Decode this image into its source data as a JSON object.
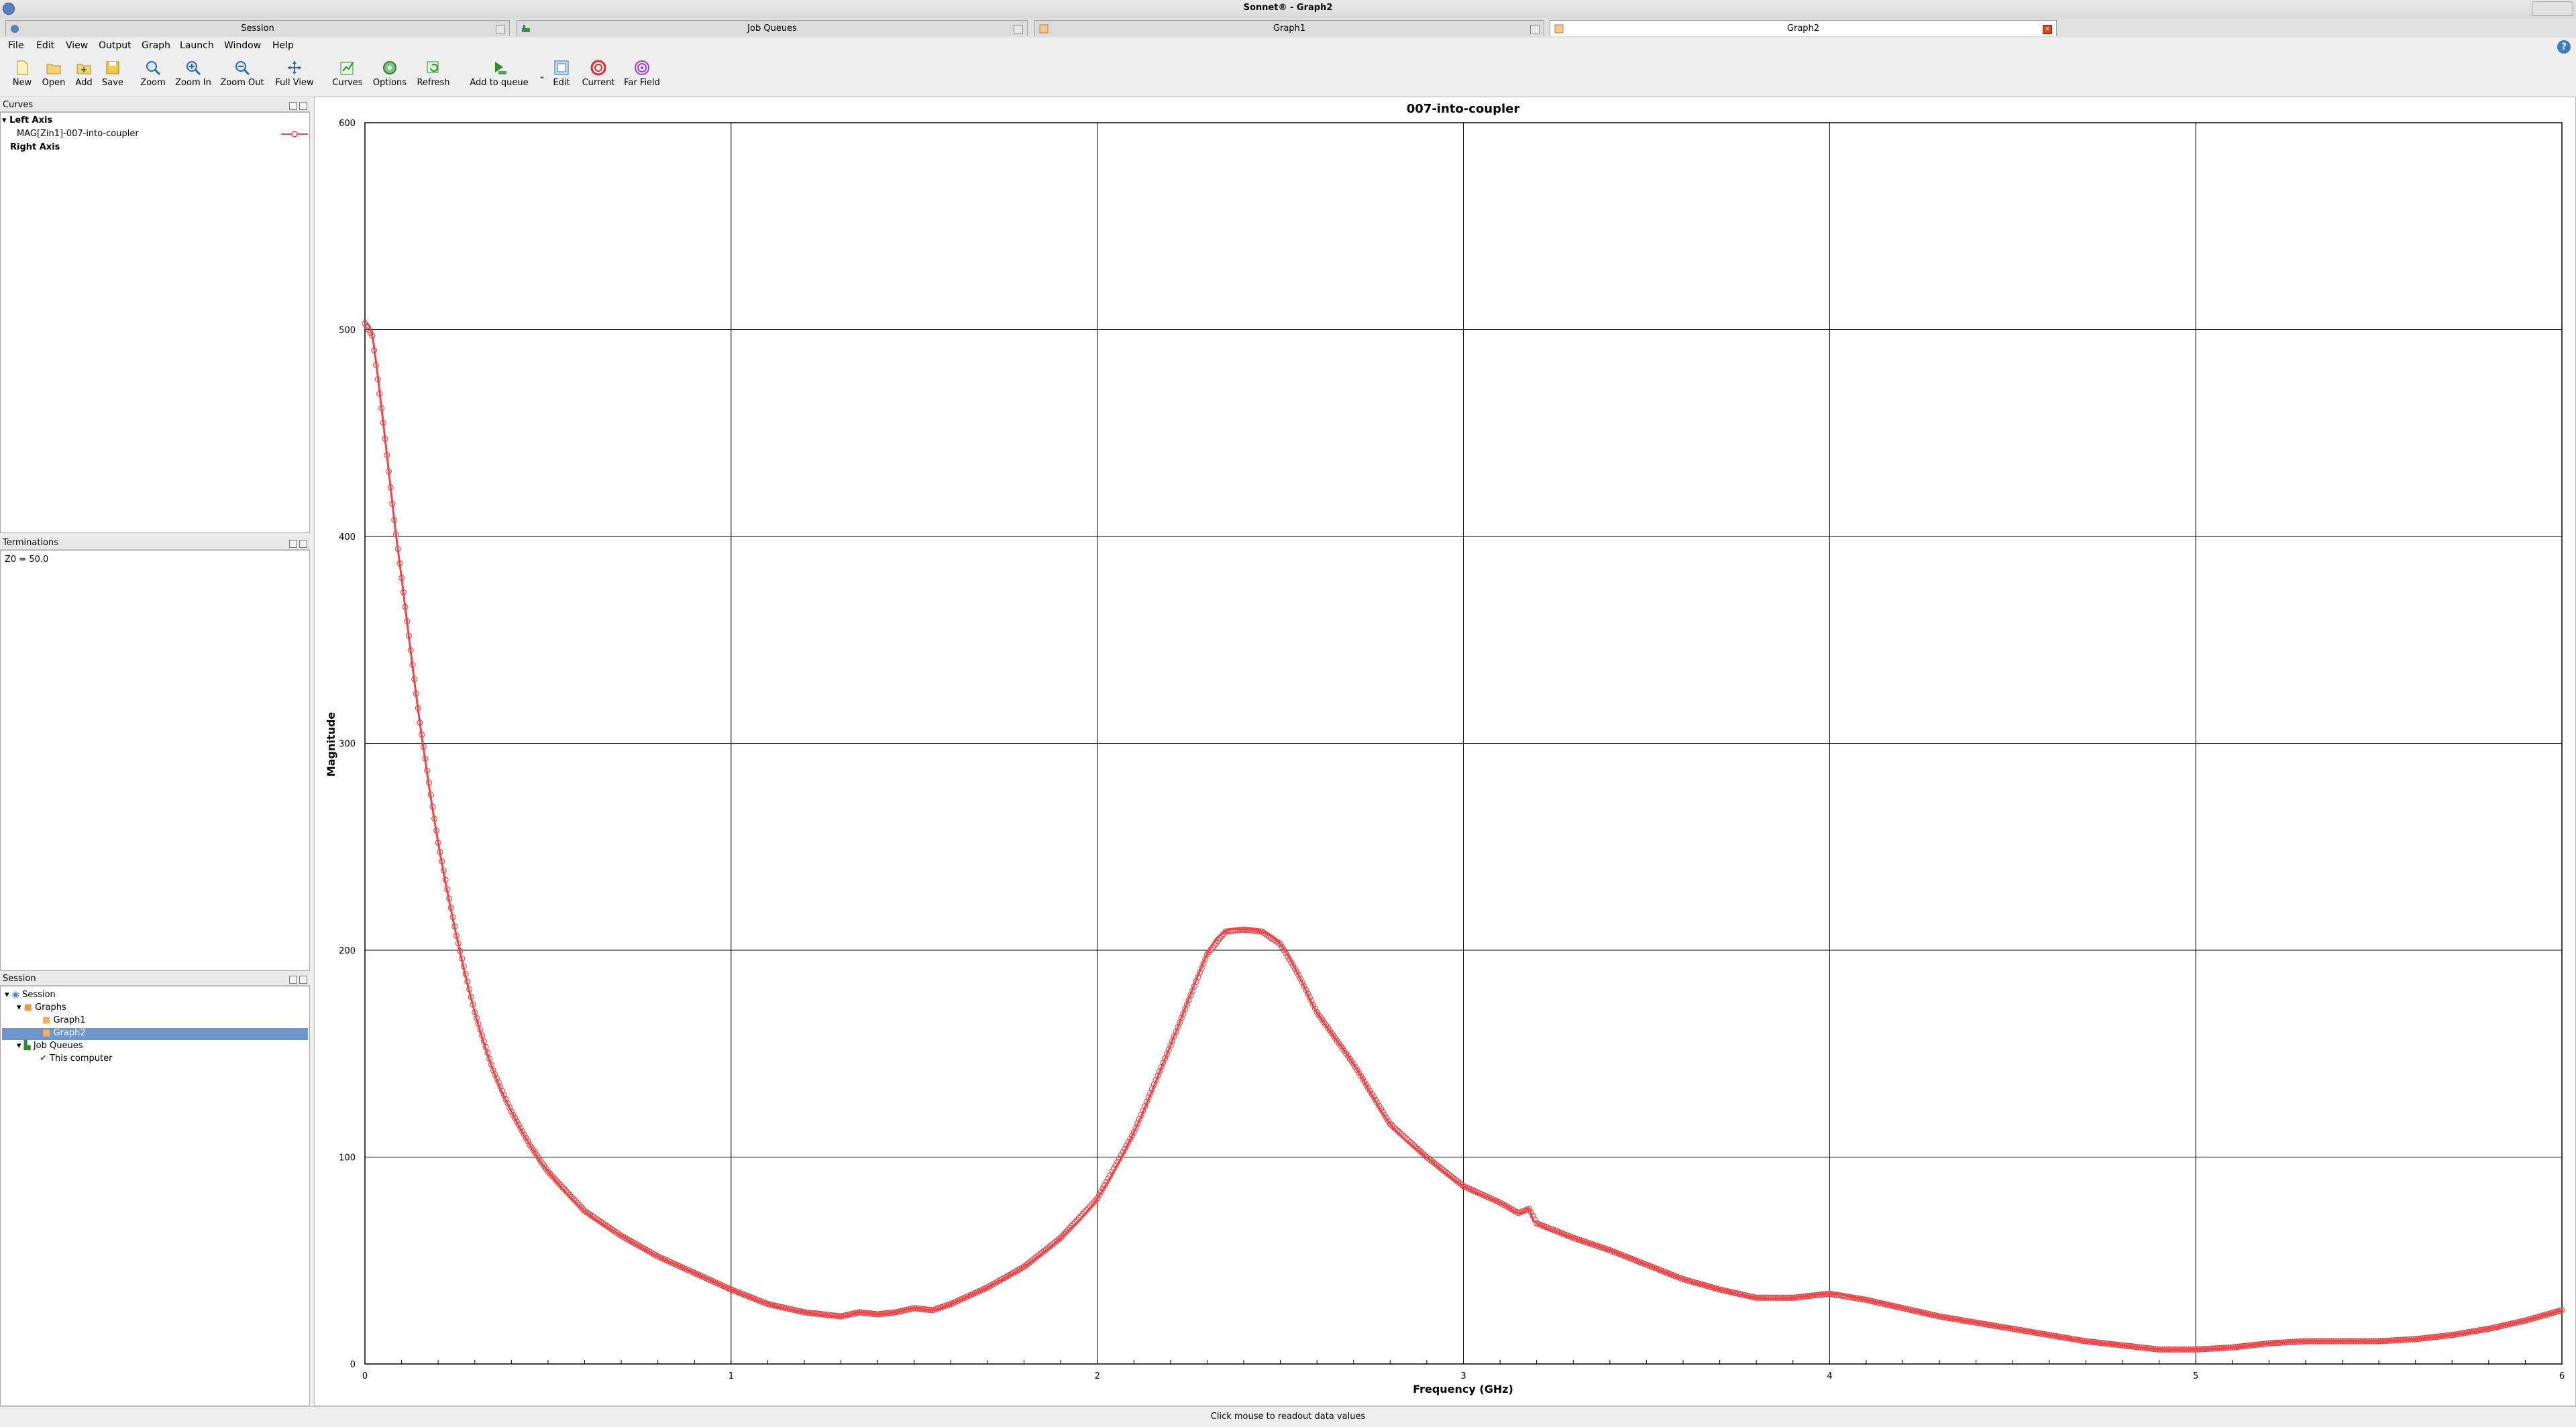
{
  "window": {
    "title": "Sonnet® - Graph2"
  },
  "tabs": [
    {
      "label": "Session",
      "active": false
    },
    {
      "label": "Job Queues",
      "active": false
    },
    {
      "label": "Graph1",
      "active": false
    },
    {
      "label": "Graph2",
      "active": true
    }
  ],
  "menu": [
    "File",
    "Edit",
    "View",
    "Output",
    "Graph",
    "Launch",
    "Window",
    "Help"
  ],
  "toolbar": {
    "new": "New",
    "open": "Open",
    "add": "Add",
    "save": "Save",
    "zoom": "Zoom",
    "zoom_in": "Zoom In",
    "zoom_out": "Zoom Out",
    "full_view": "Full View",
    "curves": "Curves",
    "options": "Options",
    "refresh": "Refresh",
    "add_to_queue": "Add to queue",
    "edit": "Edit",
    "current": "Current",
    "far_field": "Far Field"
  },
  "curves_panel": {
    "title": "Curves",
    "left_axis": "Left Axis",
    "curve": "MAG[Zin1]-007-into-coupler",
    "right_axis": "Right Axis",
    "curve_color": "#e8484a"
  },
  "terminations_panel": {
    "title": "Terminations",
    "text": "Z0 = 50.0"
  },
  "session_panel": {
    "title": "Session",
    "items": [
      "Session",
      "Graphs",
      "Graph1",
      "Graph2",
      "Job Queues",
      "This computer"
    ],
    "selected": "Graph2"
  },
  "status": {
    "text": "Click mouse to readout data values"
  },
  "chart_data": {
    "type": "line",
    "title": "007-into-coupler",
    "xlabel": "Frequency (GHz)",
    "ylabel": "Magnitude",
    "xlim": [
      0,
      6
    ],
    "ylim": [
      0,
      600
    ],
    "xticks": [
      0,
      1,
      2,
      3,
      4,
      5,
      6
    ],
    "yticks": [
      0,
      100,
      200,
      300,
      400,
      500,
      600
    ],
    "grid": true,
    "marker": "circle",
    "color": "#e8484a",
    "series": [
      {
        "name": "MAG[Zin1]-007-into-coupler",
        "x": [
          0,
          0.02,
          0.05,
          0.08,
          0.1,
          0.15,
          0.2,
          0.25,
          0.3,
          0.35,
          0.4,
          0.45,
          0.5,
          0.6,
          0.7,
          0.8,
          0.9,
          1.0,
          1.1,
          1.2,
          1.3,
          1.35,
          1.4,
          1.45,
          1.5,
          1.55,
          1.6,
          1.7,
          1.8,
          1.9,
          2.0,
          2.1,
          2.2,
          2.3,
          2.35,
          2.4,
          2.45,
          2.5,
          2.55,
          2.6,
          2.7,
          2.8,
          2.9,
          3.0,
          3.1,
          3.15,
          3.18,
          3.2,
          3.3,
          3.4,
          3.5,
          3.6,
          3.7,
          3.8,
          3.9,
          4.0,
          4.1,
          4.2,
          4.3,
          4.4,
          4.5,
          4.6,
          4.7,
          4.8,
          4.9,
          5.0,
          5.1,
          5.2,
          5.3,
          5.4,
          5.5,
          5.6,
          5.7,
          5.8,
          5.9,
          6.0
        ],
        "y": [
          503,
          497,
          455,
          408,
          380,
          310,
          252,
          207,
          170,
          142,
          122,
          106,
          93,
          74,
          62,
          52,
          44,
          36,
          29,
          25,
          23,
          25,
          24,
          25,
          27,
          26,
          29,
          37,
          47,
          61,
          80,
          112,
          154,
          198,
          209,
          210,
          209,
          203,
          188,
          170,
          145,
          116,
          100,
          86,
          78,
          73,
          75,
          68,
          61,
          55,
          48,
          41,
          36,
          32,
          32,
          34,
          31,
          27,
          23,
          20,
          17,
          14,
          11,
          9,
          7,
          7,
          8,
          10,
          11,
          11,
          11,
          12,
          14,
          17,
          21,
          26
        ]
      }
    ]
  }
}
